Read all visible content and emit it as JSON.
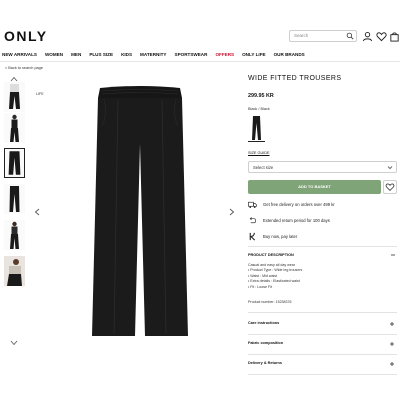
{
  "header": {
    "logo": "ONLY",
    "search_placeholder": "Search",
    "icons": [
      "search-icon",
      "user-icon",
      "heart-icon",
      "bag-icon"
    ]
  },
  "nav": {
    "items": [
      "NEW ARRIVALS",
      "WOMEN",
      "MEN",
      "PLUS SIZE",
      "KIDS",
      "MATERNITY",
      "SPORTSWEAR",
      "OFFERS",
      "ONLY LIFE",
      "OUR BRANDS"
    ]
  },
  "gallery": {
    "back_link": "< Back to search page",
    "life_tag": "LIFE",
    "thumb_count": 6,
    "active_thumb": 3
  },
  "product": {
    "title": "WIDE FITTED TROUSERS",
    "price": "299.95 KR",
    "color_label": "Black / Black",
    "size_guide": "SIZE GUIDE",
    "size_select": "Select size",
    "add_to_basket": "ADD TO BASKET",
    "usps": [
      {
        "icon": "truck-icon",
        "text": "Get free delivery on orders over 499 kr"
      },
      {
        "icon": "return-icon",
        "text": "Extended return period for 100 days"
      },
      {
        "icon": "klarna-icon",
        "text": "Buy now, pay later"
      }
    ],
    "description": {
      "title": "PRODUCT DESCRIPTION",
      "lines": [
        "Casual and easy all day wear",
        "• Product Type : Wide leg trousers",
        "• Waist : Mid waist",
        "• Extra details : Elasticated waist",
        "• Fit : Loose Fit"
      ],
      "product_number": "Product number: 15238376"
    },
    "accordions": [
      "Care instructions",
      "Fabric composition",
      "Delivery & Returns"
    ]
  },
  "colors": {
    "accent_green": "#7fa477",
    "offers_red": "#c8102e",
    "garment": "#1a1a1a"
  }
}
